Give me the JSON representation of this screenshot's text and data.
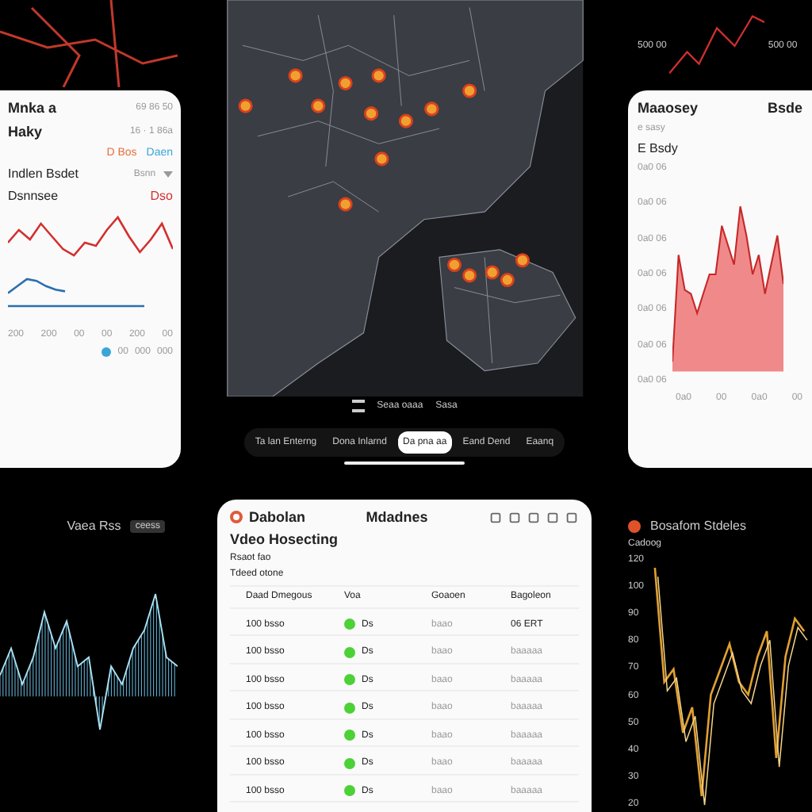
{
  "left_card": {
    "title": "Mnka a",
    "subtitle": "Haky",
    "meta": [
      "69 86 50",
      "16 · 1 86a"
    ],
    "tags": [
      {
        "label": "D Bos",
        "color": "#e8703a"
      },
      {
        "label": "Daen",
        "color": "#3aa6d8"
      }
    ],
    "filter_label": "Indlen Bsdet",
    "filter_value": "Bsnn",
    "series_label": "Dsnnsee",
    "series_value": "Dso",
    "x_labels": [
      "200",
      "200",
      "00",
      "00",
      "200",
      "00"
    ],
    "legend": [
      "00",
      "000",
      "000"
    ]
  },
  "top_right_chart": {
    "labels": [
      "500 00",
      "500 00"
    ]
  },
  "map": {
    "labels": [
      "Seaa oaaa",
      "Sasa"
    ]
  },
  "right_card": {
    "title": "Maaosey",
    "side": "Bsde",
    "subtitle": "e sasy",
    "caption": "E Bsdy",
    "y_labels": [
      "0a0 06",
      "0a0 06",
      "0a0 06",
      "0a0 06",
      "0a0 06",
      "0a0 06",
      "0a0 06"
    ],
    "x_labels": [
      "0a0",
      "00",
      "0a0",
      "00"
    ]
  },
  "tabs": [
    {
      "label": "Ta lan Enterng",
      "selected": false
    },
    {
      "label": "Dona Inlarnd",
      "selected": false
    },
    {
      "label": "Da pna aa",
      "selected": true
    },
    {
      "label": "Eand Dend",
      "selected": false
    },
    {
      "label": "Eaanq",
      "selected": false
    }
  ],
  "wave_panel": {
    "title": "Vaea Rss",
    "badge": "ceess"
  },
  "table_card": {
    "brand": "Dabolan",
    "title": "Mdadnes",
    "heading": "Vdeo Hosecting",
    "line_1": "Rsaot fao",
    "line_2": "Tdeed otone",
    "columns": [
      "Daad Dmegous",
      "Voa",
      "Goaoen",
      "Bagoleon"
    ],
    "rows": [
      {
        "id": "100 bsso",
        "status": "Ds",
        "group": "baao",
        "value": "06 ERT"
      },
      {
        "id": "100 bsso",
        "status": "Ds",
        "group": "baao",
        "value": "baaaaa"
      },
      {
        "id": "100 bsso",
        "status": "Ds",
        "group": "baao",
        "value": "baaaaa"
      },
      {
        "id": "100 bsso",
        "status": "Ds",
        "group": "baao",
        "value": "baaaaa"
      },
      {
        "id": "100 bsso",
        "status": "Ds",
        "group": "baao",
        "value": "baaaaa"
      },
      {
        "id": "100 bsso",
        "status": "Ds",
        "group": "baao",
        "value": "baaaaa"
      },
      {
        "id": "100 bsso",
        "status": "Ds",
        "group": "baao",
        "value": "baaaaa"
      }
    ]
  },
  "chart_panel": {
    "title": "Bosafom Stdeles",
    "subtitle": "Cadoog",
    "y_labels": [
      "120",
      "100",
      "90",
      "80",
      "70",
      "60",
      "50",
      "40",
      "30",
      "20"
    ]
  }
}
